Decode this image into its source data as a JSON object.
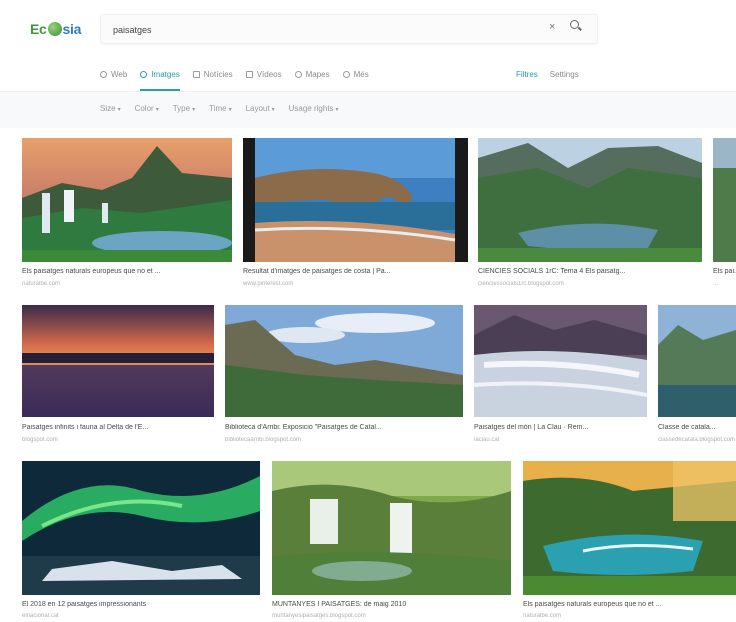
{
  "header": {
    "logo_part1": "Ec",
    "logo_part2": "sia",
    "search_value": "paisatges",
    "clear_glyph": "×"
  },
  "tabs": [
    {
      "label": "Web",
      "icon": "magnifier-icon"
    },
    {
      "label": "Imatges",
      "icon": "image-icon"
    },
    {
      "label": "Notícies",
      "icon": "newspaper-icon"
    },
    {
      "label": "Vídeos",
      "icon": "play-icon"
    },
    {
      "label": "Mapes",
      "icon": "map-pin-icon"
    },
    {
      "label": "Més",
      "icon": "more-icon"
    }
  ],
  "right_tabs": {
    "filters": "Filtres",
    "settings": "Settings"
  },
  "filters": [
    "Size",
    "Color",
    "Type",
    "Time",
    "Layout",
    "Usage rights"
  ],
  "results": [
    {
      "caption": "Els paisatges naturals europeus que no et ...",
      "source": "naturalbe.com"
    },
    {
      "caption": "Resultat d'imatges de paisatges de costa | Pa...",
      "source": "www.pinterest.com"
    },
    {
      "caption": "CIÈNCIES SOCIALS 1rC: Tema 4 Els paisatg...",
      "source": "cienciessocials1rc.blogspot.com"
    },
    {
      "caption": "Els pai...",
      "source": "..."
    },
    {
      "caption": "Paisatges infinits i fauna al Delta de l'E...",
      "source": "blogspot.com"
    },
    {
      "caption": "Biblioteca d'Arribi: Exposició \"Paisatges de Catal...",
      "source": "bibliotecaarribi.blogspot.com"
    },
    {
      "caption": "Paisatges del món | La Clau · Rem...",
      "source": "laclau.cat"
    },
    {
      "caption": "Classe de catala...",
      "source": "classedecatala.blogspot.com"
    },
    {
      "caption": "El 2018 en 12 paisatges impressionants",
      "source": "elnacional.cat"
    },
    {
      "caption": "MUNTANYES I PAISATGES: de maig 2010",
      "source": "muntanyesipaisatges.blogspot.com"
    },
    {
      "caption": "Els paisatges naturals europeus que no et ...",
      "source": "naturalbe.com"
    }
  ],
  "colors": {
    "accent": "#2b9ea8",
    "filterbar": "#f8f9fa"
  }
}
